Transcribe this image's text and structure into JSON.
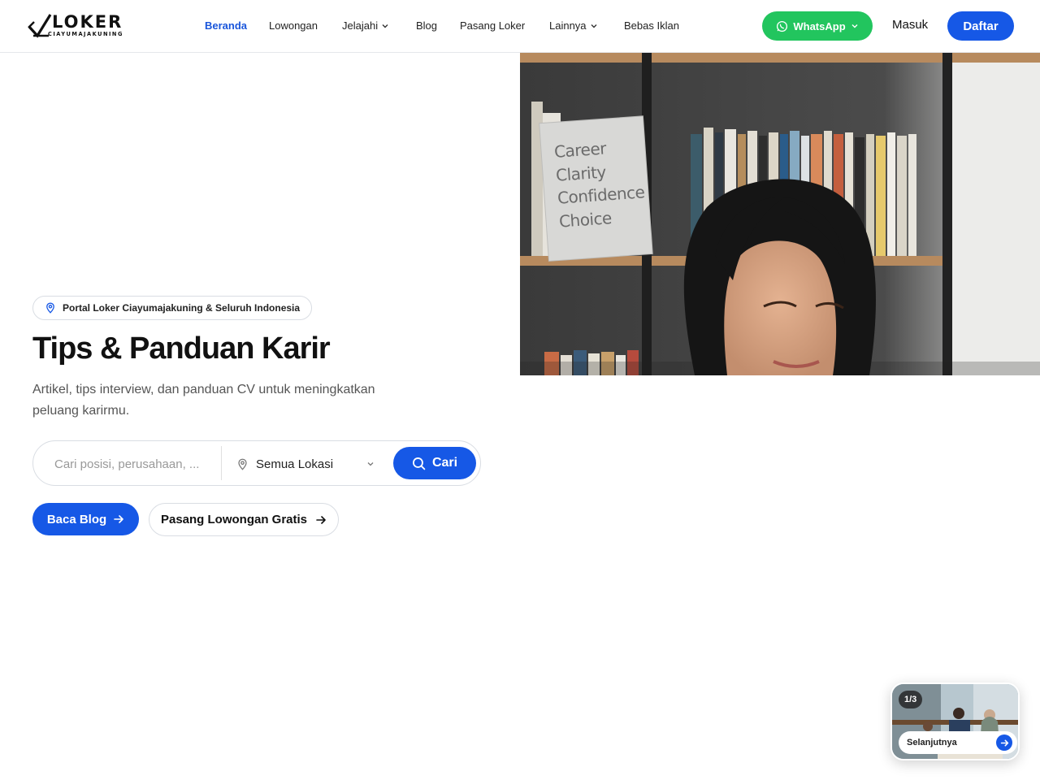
{
  "brand": {
    "name": "LOKER",
    "sub": "CIAYUMAJAKUNING"
  },
  "nav": [
    {
      "label": "Beranda",
      "active": true
    },
    {
      "label": "Lowongan"
    },
    {
      "label": "Jelajahi",
      "dropdown": true
    },
    {
      "label": "Blog"
    },
    {
      "label": "Pasang Loker"
    },
    {
      "label": "Lainnya",
      "dropdown": true
    },
    {
      "label": "Bebas Iklan"
    }
  ],
  "header": {
    "whatsapp_label": "WhatsApp",
    "login_label": "Masuk",
    "register_label": "Daftar"
  },
  "hero": {
    "badge": "Portal Loker Ciayumajakuning & Seluruh Indonesia",
    "title": "Tips & Panduan Karir",
    "subtitle": "Artikel, tips interview, dan panduan CV untuk meningkatkan peluang karirmu.",
    "image_sign": [
      "Career",
      "Clarity",
      "Confidence",
      "Choice"
    ]
  },
  "search": {
    "placeholder": "Cari posisi, perusahaan, ...",
    "location_value": "Semua Lokasi",
    "button_label": "Cari"
  },
  "actions": {
    "blog_label": "Baca Blog",
    "post_label": "Pasang Lowongan Gratis"
  },
  "slider_card": {
    "counter": "1/3",
    "next_label": "Selanjutnya"
  },
  "colors": {
    "primary": "#1658e6",
    "whatsapp": "#22c55e",
    "active_nav": "#1a56db"
  }
}
